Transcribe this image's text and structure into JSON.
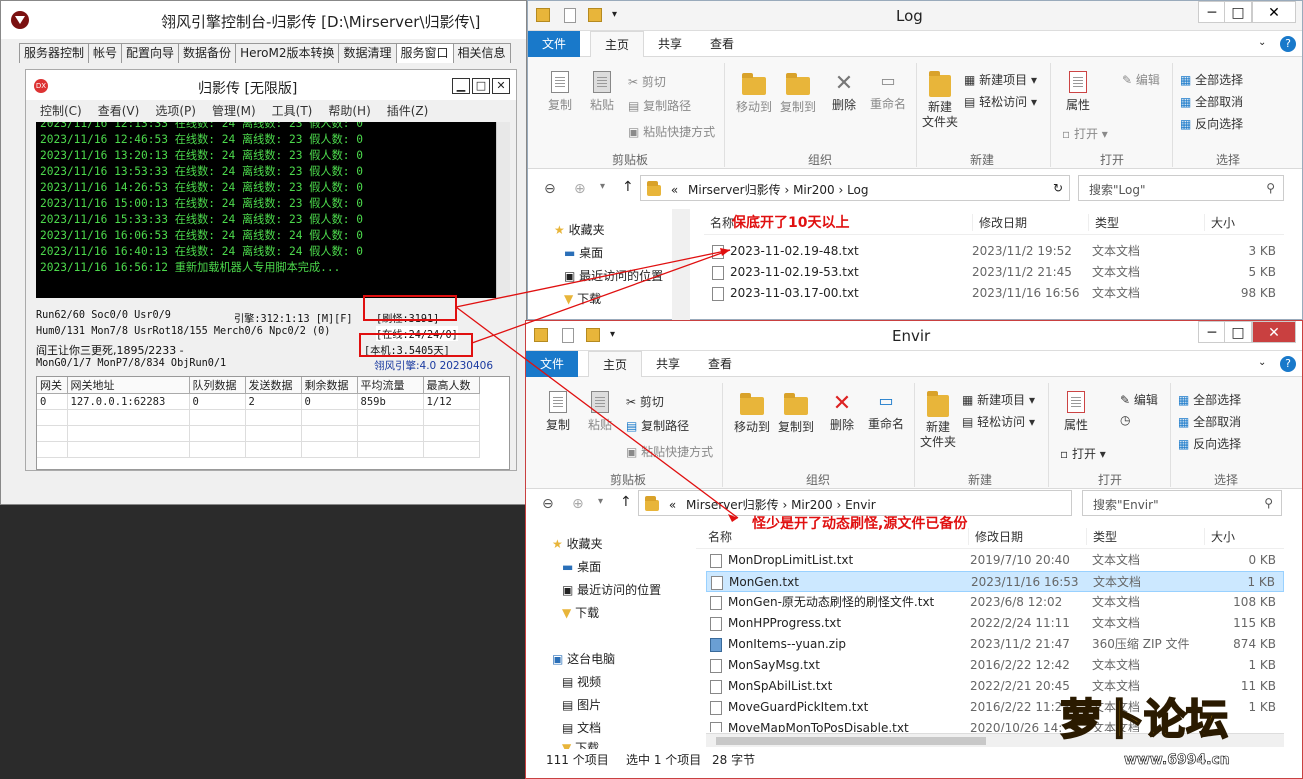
{
  "console": {
    "title": "翎风引擎控制台-归影传 [D:\\Mirserver\\归影传\\]",
    "tabs": [
      "服务器控制",
      "帐号",
      "配置向导",
      "数据备份",
      "HeroM2版本转换",
      "数据清理",
      "服务窗口",
      "相关信息"
    ],
    "active_tab": "服务窗口",
    "inner": {
      "title": "归影传 [无限版]",
      "menu": [
        "控制(C)",
        "查看(V)",
        "选项(P)",
        "管理(M)",
        "工具(T)",
        "帮助(H)",
        "插件(Z)"
      ],
      "log_lines": [
        "2023/11/16 12:13:33 在线数: 24 离线数: 23 假人数: 0",
        "2023/11/16 12:46:53 在线数: 24 离线数: 23 假人数: 0",
        "2023/11/16 13:20:13 在线数: 24 离线数: 23 假人数: 0",
        "2023/11/16 13:53:33 在线数: 24 离线数: 23 假人数: 0",
        "2023/11/16 14:26:53 在线数: 24 离线数: 23 假人数: 0",
        "2023/11/16 15:00:13 在线数: 24 离线数: 23 假人数: 0",
        "2023/11/16 15:33:33 在线数: 24 离线数: 23 假人数: 0",
        "2023/11/16 16:06:53 在线数: 24 离线数: 24 假人数: 0",
        "2023/11/16 16:40:13 在线数: 24 离线数: 24 假人数: 0",
        "2023/11/16 16:56:12 重新加载机器人专用脚本完成..."
      ],
      "status": {
        "row1_left": "Run62/60 Soc0/0 Usr0/9",
        "row1_mid": "引擎:312:1:13 [M][F]",
        "refresh": "[刷怪:3191]",
        "row2_left": "Hum0/131 Mon7/8 UsrRot18/155 Merch0/6 Npc0/2 (0)",
        "online": "[在线:24/24/0]",
        "row3_left": "阎王让你三更死,1895/2233 -",
        "uptime": "[本机:3.5405天]",
        "row4_left": "MonG0/1/7 MonP7/8/834 ObjRun0/1",
        "engine": "翎风引擎:4.0 20230406"
      },
      "grid": {
        "headers": [
          "网关",
          "网关地址",
          "队列数据",
          "发送数据",
          "剩余数据",
          "平均流量",
          "最高人数"
        ],
        "rows": [
          [
            "0",
            "127.0.0.1:62283",
            "0",
            "2",
            "0",
            "859b",
            "1/12"
          ]
        ]
      }
    }
  },
  "log_window": {
    "title": "Log",
    "ribbon_tabs": [
      "文件",
      "主页",
      "共享",
      "查看"
    ],
    "ribbon": {
      "copy": "复制",
      "paste": "粘贴",
      "cut": "剪切",
      "copy_path": "复制路径",
      "paste_shortcut": "粘贴快捷方式",
      "clipboard": "剪贴板",
      "move_to": "移动到",
      "copy_to": "复制到",
      "delete": "删除",
      "rename": "重命名",
      "organize": "组织",
      "new_folder": "新建\n文件夹",
      "new_item": "新建项目",
      "easy_access": "轻松访问",
      "new": "新建",
      "properties": "属性",
      "open_btn": "打开",
      "edit": "编辑",
      "open": "打开",
      "select_all": "全部选择",
      "select_none": "全部取消",
      "invert": "反向选择",
      "select": "选择"
    },
    "path": [
      "Mirserver归影传",
      "Mir200",
      "Log"
    ],
    "search_placeholder": "搜索\"Log\"",
    "nav": [
      "收藏夹",
      "桌面",
      "最近访问的位置",
      "下载"
    ],
    "columns": [
      "名称",
      "修改日期",
      "类型",
      "大小"
    ],
    "files": [
      {
        "name": "2023-11-02.19-48.txt",
        "date": "2023/11/2 19:52",
        "type": "文本文档",
        "size": "3 KB"
      },
      {
        "name": "2023-11-02.19-53.txt",
        "date": "2023/11/2 21:45",
        "type": "文本文档",
        "size": "5 KB"
      },
      {
        "name": "2023-11-03.17-00.txt",
        "date": "2023/11/16 16:56",
        "type": "文本文档",
        "size": "98 KB"
      }
    ]
  },
  "envir_window": {
    "title": "Envir",
    "path": [
      "Mirserver归影传",
      "Mir200",
      "Envir"
    ],
    "search_placeholder": "搜索\"Envir\"",
    "nav": [
      "收藏夹",
      "桌面",
      "最近访问的位置",
      "下载",
      "这台电脑",
      "视频",
      "图片",
      "文档",
      "下载"
    ],
    "files": [
      {
        "name": "MonDropLimitList.txt",
        "date": "2019/7/10 20:40",
        "type": "文本文档",
        "size": "0 KB"
      },
      {
        "name": "MonGen.txt",
        "date": "2023/11/16 16:53",
        "type": "文本文档",
        "size": "1 KB"
      },
      {
        "name": "MonGen-原无动态刷怪的刷怪文件.txt",
        "date": "2023/6/8 12:02",
        "type": "文本文档",
        "size": "108 KB"
      },
      {
        "name": "MonHPProgress.txt",
        "date": "2022/2/24 11:11",
        "type": "文本文档",
        "size": "115 KB"
      },
      {
        "name": "MonItems--yuan.zip",
        "date": "2023/11/2 21:47",
        "type": "360压缩 ZIP 文件",
        "size": "874 KB"
      },
      {
        "name": "MonSayMsg.txt",
        "date": "2016/2/22 12:42",
        "type": "文本文档",
        "size": "1 KB"
      },
      {
        "name": "MonSpAbilList.txt",
        "date": "2022/2/21 20:45",
        "type": "文本文档",
        "size": "11 KB"
      },
      {
        "name": "MoveGuardPickItem.txt",
        "date": "2016/2/22 11:23",
        "type": "文本文档",
        "size": "1 KB"
      },
      {
        "name": "MoveMapMonToPosDisable.txt",
        "date": "2020/10/26 14:",
        "type": "文本文档",
        "size": ""
      }
    ],
    "statusbar": {
      "count": "111 个项目",
      "selected": "选中 1 个项目",
      "bytes": "28 字节"
    }
  },
  "annotations": {
    "log_note": "保底开了10天以上",
    "envir_note": "怪少是开了动态刷怪,源文件已备份"
  },
  "watermark": {
    "text": "萝卜论坛",
    "url": "www.6994.cn"
  },
  "colors": {
    "accent": "#1979ca",
    "annotation": "#e01010",
    "console_green": "#4cd94c"
  }
}
